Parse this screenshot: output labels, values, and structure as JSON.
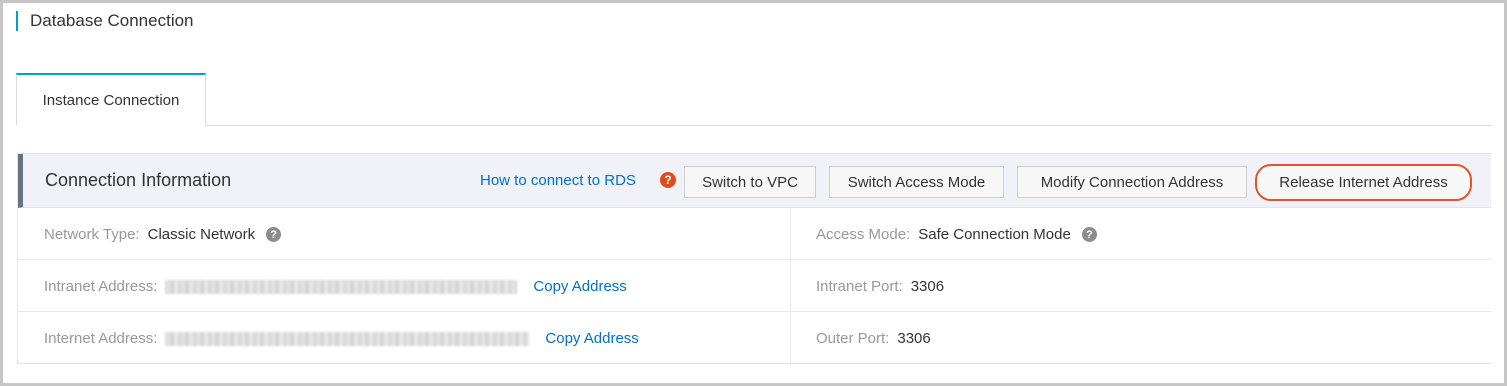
{
  "section": {
    "title": "Database Connection"
  },
  "tabs": [
    {
      "label": "Instance Connection"
    }
  ],
  "panel": {
    "title": "Connection Information",
    "help_link": "How to connect to RDS",
    "help_icon": "?",
    "buttons": {
      "switch_vpc": "Switch to VPC",
      "switch_access_mode": "Switch Access Mode",
      "modify_address": "Modify Connection Address",
      "release_internet": "Release Internet Address"
    }
  },
  "info": {
    "network_type": {
      "label": "Network Type:",
      "value": "Classic Network"
    },
    "access_mode": {
      "label": "Access Mode:",
      "value": "Safe Connection Mode"
    },
    "intranet_address": {
      "label": "Intranet Address:",
      "copy": "Copy Address"
    },
    "intranet_port": {
      "label": "Intranet Port:",
      "value": "3306"
    },
    "internet_address": {
      "label": "Internet Address:",
      "copy": "Copy Address"
    },
    "outer_port": {
      "label": "Outer Port:",
      "value": "3306"
    }
  },
  "colors": {
    "accent": "#00a2ca",
    "link": "#0070cc",
    "highlight": "#e2542c"
  }
}
